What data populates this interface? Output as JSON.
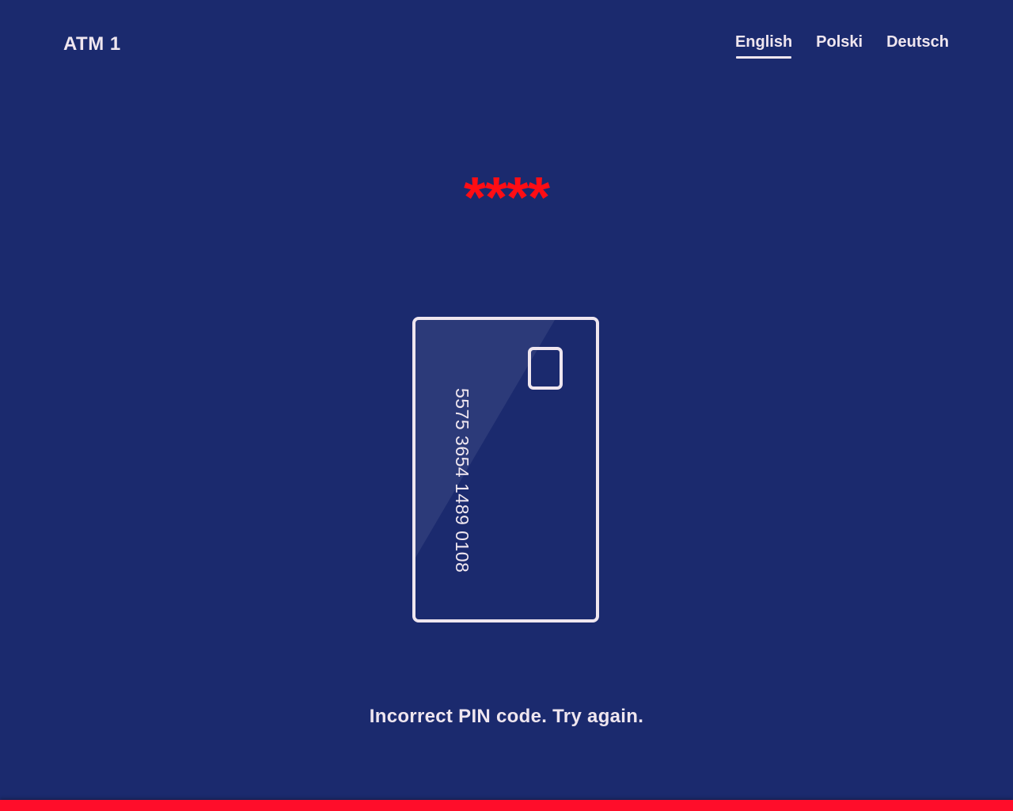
{
  "header": {
    "title": "ATM 1",
    "languages": [
      {
        "label": "English",
        "active": true
      },
      {
        "label": "Polski",
        "active": false
      },
      {
        "label": "Deutsch",
        "active": false
      }
    ]
  },
  "pin": {
    "masked_value": "****"
  },
  "card": {
    "number": "5575 3654 1489 0108",
    "icon": "credit-card-icon"
  },
  "status": {
    "message": "Incorrect PIN code. Try again."
  },
  "colors": {
    "background": "#1b2a6e",
    "text": "#efe6ef",
    "accent": "#ff0d14"
  }
}
